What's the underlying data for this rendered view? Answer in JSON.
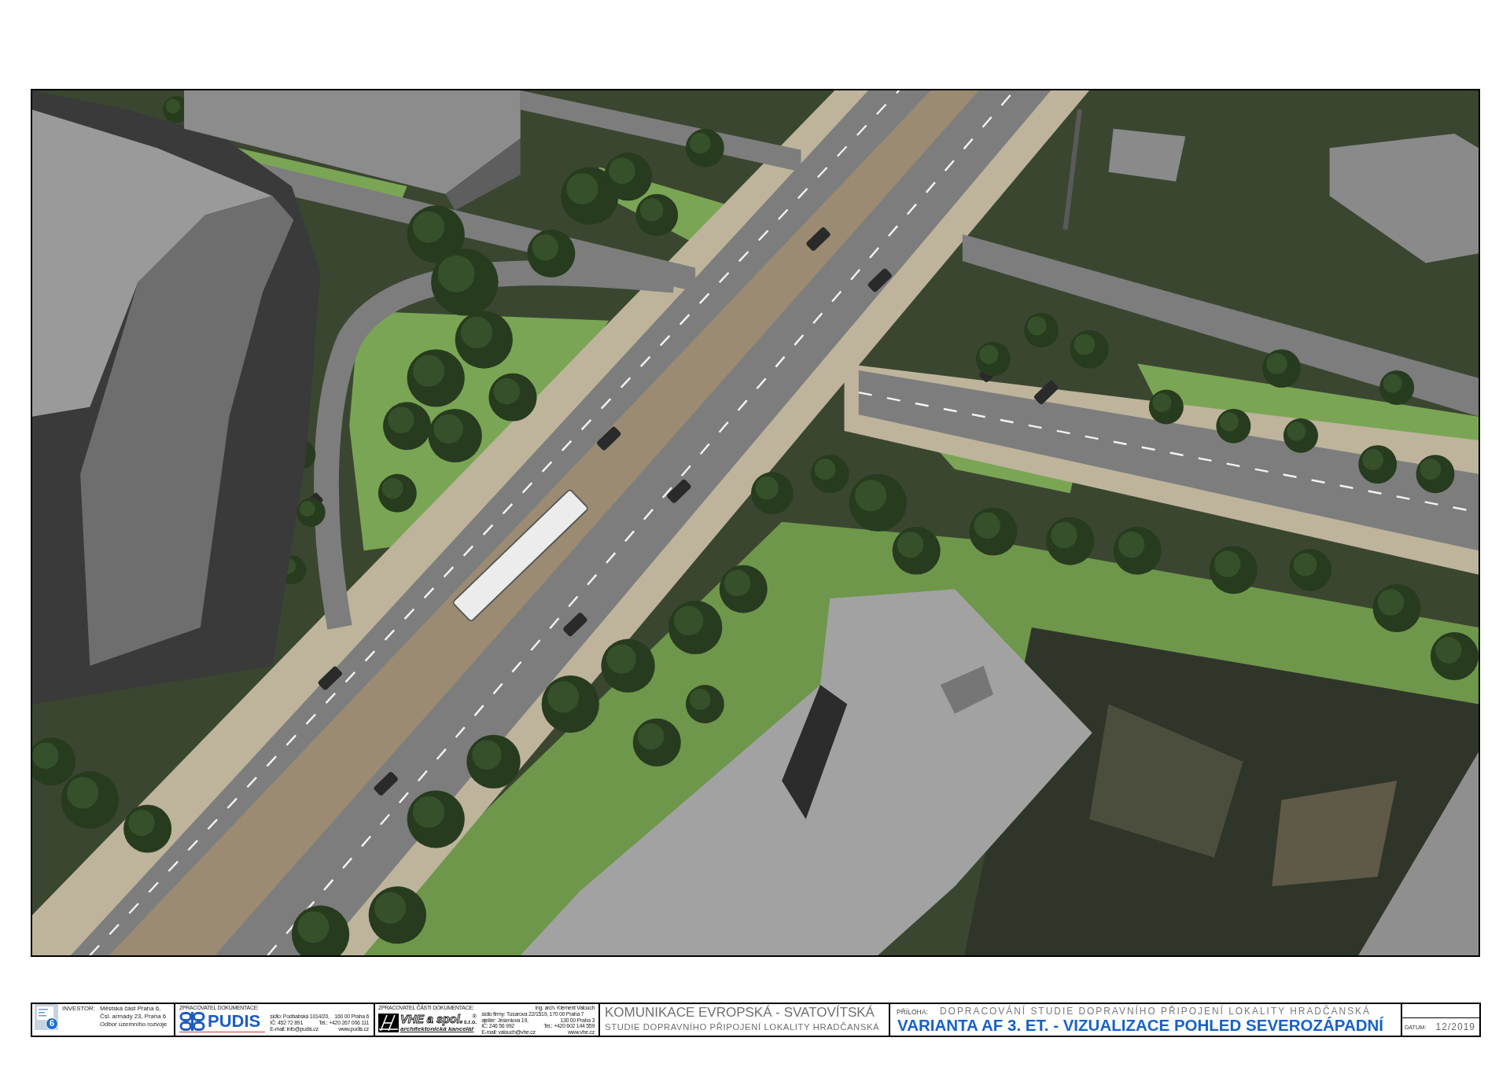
{
  "title_block": {
    "investor": {
      "label": "INVESTOR:",
      "logo_number": "6",
      "lines": [
        "Městská část Praha 6,",
        "Čsl. armády 23, Praha 6",
        "Odbor územního rozvoje"
      ]
    },
    "documentation_by": {
      "label": "ZPRACOVATEL DOKUMENTACE:",
      "logo_text": "PUDIS",
      "contact": [
        [
          "sídlo: Podbabská 1014/20,",
          "160 00 Praha 6"
        ],
        [
          "IČ: 452 72 891",
          "Tel.: +420 267 006 111"
        ],
        [
          "E-mail: info@pudis.cz",
          "www.pudis.cz"
        ]
      ]
    },
    "partial_documentation_by": {
      "label": "ZPRACOVATEL ČÁSTI DOKUMENTACE:",
      "person": "Ing. arch. Klement Valouch",
      "logo_text": "VHE a spol.",
      "logo_mark": "®",
      "logo_suffix": "s.r.o.",
      "logo_subtitle": "architektonická kancelář",
      "contact": [
        [
          "sídlo firmy: Tusarova 22/1519, 170 00 Praha 7"
        ],
        [
          "atelier: Jeseniova 19,",
          "130 00 Praha 3"
        ],
        [
          "IČ: 246 56 992",
          "Tel.: +420 602 144 559"
        ],
        [
          "E-mail: valouch@vhe.cz",
          "www.vhe.cz"
        ]
      ]
    },
    "project": {
      "title": "KOMUNIKACE EVROPSKÁ - SVATOVÍTSKÁ",
      "subtitle": "STUDIE DOPRAVNÍHO PŘIPOJENÍ LOKALITY HRADČANSKÁ"
    },
    "attachment": {
      "label": "PŘÍLOHA:",
      "study": "DOPRACOVÁNÍ STUDIE DOPRAVNÍHO PŘIPOJENÍ LOKALITY HRADČANSKÁ",
      "title": "VARIANTA AF 3. ET. - VIZUALIZACE POHLED SEVEROZÁPADNÍ"
    },
    "date": {
      "label": "DATUM:",
      "value": "12/2019"
    }
  }
}
